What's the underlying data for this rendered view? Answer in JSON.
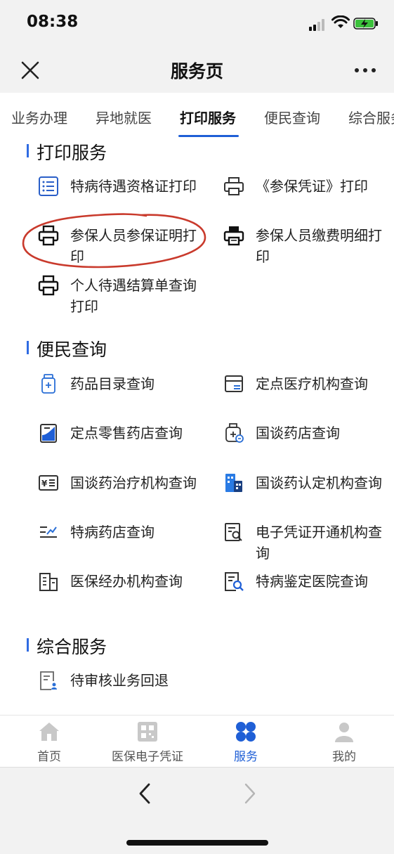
{
  "status_bar": {
    "time": "08:38"
  },
  "nav": {
    "title": "服务页"
  },
  "tabs": [
    {
      "label": "业务办理"
    },
    {
      "label": "异地就医"
    },
    {
      "label": "打印服务"
    },
    {
      "label": "便民查询"
    },
    {
      "label": "综合服务"
    }
  ],
  "active_tab": "打印服务",
  "sections": {
    "print": {
      "title": "打印服务",
      "items": [
        {
          "label": "特病待遇资格证打印",
          "icon": "list-icon"
        },
        {
          "label": "《参保凭证》打印",
          "icon": "printer-icon"
        },
        {
          "label": "参保人员参保证明打印",
          "icon": "printer-icon"
        },
        {
          "label": "参保人员缴费明细打印",
          "icon": "printer-icon"
        },
        {
          "label": "个人待遇结算单查询打印",
          "icon": "printer-icon"
        }
      ]
    },
    "query": {
      "title": "便民查询",
      "items": [
        {
          "label": "药品目录查询",
          "icon": "medicine-bottle-icon"
        },
        {
          "label": "定点医疗机构查询",
          "icon": "institution-icon"
        },
        {
          "label": "定点零售药店查询",
          "icon": "pharmacy-icon"
        },
        {
          "label": "国谈药店查询",
          "icon": "drug-search-icon"
        },
        {
          "label": "国谈药治疗机构查询",
          "icon": "yuan-card-icon"
        },
        {
          "label": "国谈药认定机构查询",
          "icon": "building-icon"
        },
        {
          "label": "特病药店查询",
          "icon": "list-arrow-icon"
        },
        {
          "label": "电子凭证开通机构查询",
          "icon": "document-search-icon"
        },
        {
          "label": "医保经办机构查询",
          "icon": "office-building-icon"
        },
        {
          "label": "特病鉴定医院查询",
          "icon": "document-magnifier-icon"
        }
      ]
    },
    "general": {
      "title": "综合服务",
      "items": [
        {
          "label": "待审核业务回退",
          "icon": "document-user-icon"
        }
      ]
    }
  },
  "bottom_tabs": [
    {
      "label": "首页",
      "icon": "home-icon"
    },
    {
      "label": "医保电子凭证",
      "icon": "qr-code-icon"
    },
    {
      "label": "服务",
      "icon": "services-icon"
    },
    {
      "label": "我的",
      "icon": "user-icon"
    }
  ],
  "colors": {
    "accent": "#1f5fd6",
    "annotation": "#c93a2c"
  }
}
